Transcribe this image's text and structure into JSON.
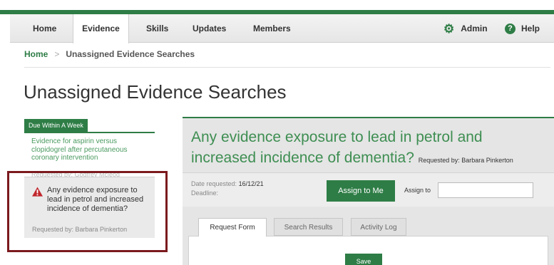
{
  "nav": {
    "items": [
      {
        "label": "Home"
      },
      {
        "label": "Evidence"
      },
      {
        "label": "Skills"
      },
      {
        "label": "Updates"
      },
      {
        "label": "Members"
      }
    ],
    "admin_label": "Admin",
    "help_label": "Help"
  },
  "breadcrumb": {
    "home": "Home",
    "current": "Unassigned Evidence Searches"
  },
  "page_title": "Unassigned Evidence Searches",
  "sidebar": {
    "section_label": "Due Within A Week",
    "items": [
      {
        "title": "Evidence for aspirin versus clopidogrel after percutaneous coronary intervention",
        "requested_by": "Requested by: Godfrey Mcleod"
      },
      {
        "title": "Any evidence exposure to lead in petrol and increased incidence of dementia?",
        "requested_by": "Requested by: Barbara Pinkerton",
        "icon": "warning-icon"
      }
    ]
  },
  "detail": {
    "title": "Any evidence exposure to lead in petrol and increased incidence of dementia?",
    "requested_by": "Requested by: Barbara Pinkerton",
    "date_requested_label": "Date requested:",
    "date_requested_value": "16/12/21",
    "deadline_label": "Deadline:",
    "assign_to_me_label": "Assign to Me",
    "assign_to_label": "Assign to",
    "assign_to_value": "",
    "tabs": [
      {
        "label": "Request Form"
      },
      {
        "label": "Search Results"
      },
      {
        "label": "Activity Log"
      }
    ],
    "save_label": "Save"
  },
  "colors": {
    "brand_green": "#2e7d46",
    "highlight_red": "#7b1a1e",
    "warning_red": "#c0272d"
  }
}
